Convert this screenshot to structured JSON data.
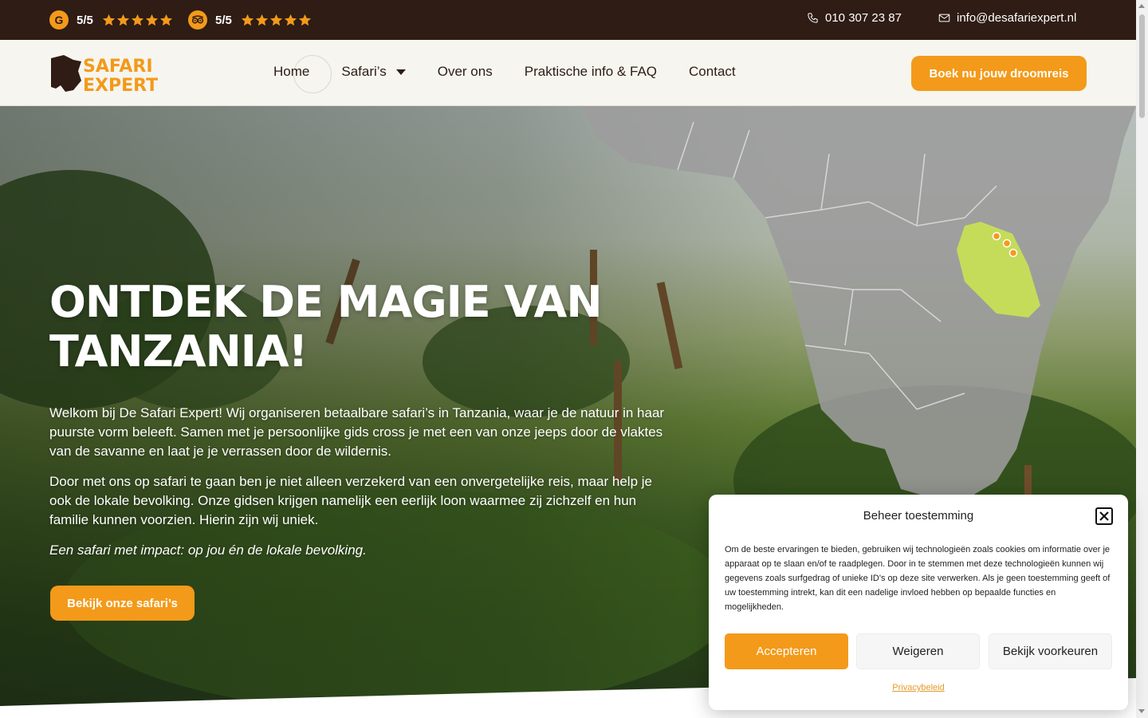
{
  "topbar": {
    "ratings": [
      {
        "source_icon": "google-g-icon",
        "badge": "G",
        "score": "5/5",
        "stars": 5
      },
      {
        "source_icon": "tripadvisor-icon",
        "badge": "",
        "score": "5/5",
        "stars": 5
      }
    ],
    "phone": "010 307 23 87",
    "email": "info@desafariexpert.nl"
  },
  "nav": {
    "logo_line1": "SAFARI",
    "logo_line2": "EXPERT",
    "links": [
      "Home",
      "Safari’s",
      "Over ons",
      "Praktische info & FAQ",
      "Contact"
    ],
    "cta": "Boek nu jouw droomreis"
  },
  "hero": {
    "title": "ONTDEK DE MAGIE VAN TANZANIA!",
    "p1": "Welkom bij De Safari Expert! Wij organiseren betaalbare safari’s in Tanzania, waar je de natuur in haar puurste vorm beleeft. Samen met je persoonlijke gids cross je met een van onze jeeps door de vlaktes van de savanne en laat je je verrassen door de wildernis.",
    "p2": "Door met ons op safari te gaan ben je niet alleen verzekerd van een onvergetelijke reis, maar help je ook de lokale bevolking. Onze gidsen krijgen namelijk een eerlijk loon waarmee zij zichzelf en hun familie kunnen voorzien. Hierin zijn wij uniek.",
    "p3": "Een safari met impact: op jou én de lokale bevolking.",
    "cta": "Bekijk onze safari’s"
  },
  "cookie": {
    "title": "Beheer toestemming",
    "text": "Om de beste ervaringen te bieden, gebruiken wij technologieën zoals cookies om informatie over je apparaat op te slaan en/of te raadplegen. Door in te stemmen met deze technologieën kunnen wij gegevens zoals surfgedrag of unieke ID's op deze site verwerken. Als je geen toestemming geeft of uw toestemming intrekt, kan dit een nadelige invloed hebben op bepaalde functies en mogelijkheden.",
    "accept": "Accepteren",
    "deny": "Weigeren",
    "prefs": "Bekijk voorkeuren",
    "privacy": "Privacybeleid"
  },
  "colors": {
    "accent": "#f39a1a",
    "topbar": "#2e1c15",
    "navbar": "#f6f5ef",
    "tanzania": "#c5dc5a"
  }
}
